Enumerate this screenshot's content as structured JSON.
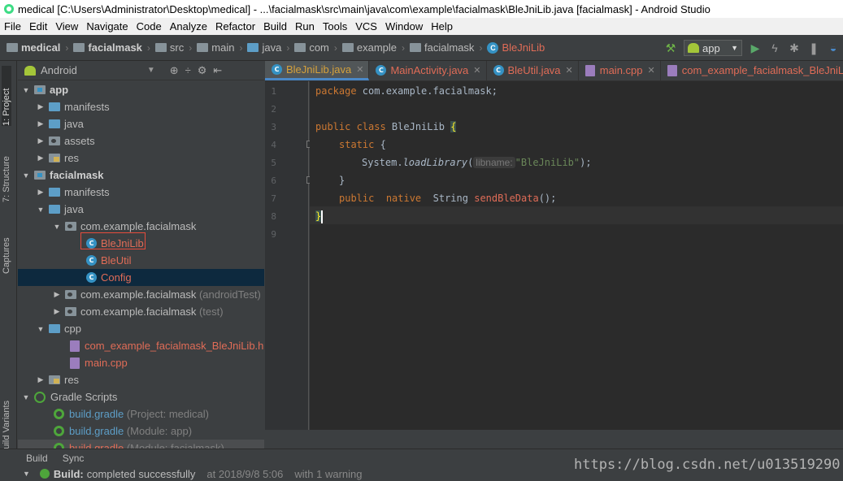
{
  "window": {
    "title": "medical [C:\\Users\\Administrator\\Desktop\\medical] - ...\\facialmask\\src\\main\\java\\com\\example\\facialmask\\BleJniLib.java [facialmask] - Android Studio"
  },
  "menu": [
    "File",
    "Edit",
    "View",
    "Navigate",
    "Code",
    "Analyze",
    "Refactor",
    "Build",
    "Run",
    "Tools",
    "VCS",
    "Window",
    "Help"
  ],
  "breadcrumb": {
    "c0": "medical",
    "c1": "facialmask",
    "c2": "src",
    "c3": "main",
    "c4": "java",
    "c5": "com",
    "c6": "example",
    "c7": "facialmask",
    "c8": "BleJniLib"
  },
  "run_config": "app",
  "left_tabs": {
    "project": "1: Project",
    "structure": "7: Structure",
    "captures": "Captures",
    "variants": "Build Variants"
  },
  "project": {
    "view": "Android",
    "tree": {
      "app": "app",
      "app_manifests": "manifests",
      "app_java": "java",
      "app_assets": "assets",
      "app_res": "res",
      "facialmask": "facialmask",
      "fm_manifests": "manifests",
      "fm_java": "java",
      "pkg_main": "com.example.facialmask",
      "blejnilib": "BleJniLib",
      "bleutil": "BleUtil",
      "config": "Config",
      "pkg_android_test": "com.example.facialmask",
      "pkg_android_test_hint": "(androidTest)",
      "pkg_test": "com.example.facialmask",
      "pkg_test_hint": "(test)",
      "cpp": "cpp",
      "header_file": "com_example_facialmask_BleJniLib.h",
      "main_cpp": "main.cpp",
      "fm_res": "res",
      "gradle_scripts": "Gradle Scripts",
      "bg1": "build.gradle",
      "bg1_hint": "(Project: medical)",
      "bg2": "build.gradle",
      "bg2_hint": "(Module: app)",
      "bg3": "build.gradle",
      "bg3_hint": "(Module: facialmask)"
    }
  },
  "editor": {
    "tabs": {
      "t0": "BleJniLib.java",
      "t1": "MainActivity.java",
      "t2": "BleUtil.java",
      "t3": "main.cpp",
      "t4": "com_example_facialmask_BleJniLib.h"
    },
    "line_numbers": [
      "1",
      "2",
      "3",
      "4",
      "5",
      "6",
      "7",
      "8",
      "9"
    ],
    "code": {
      "l1_kw": "package",
      "l1_rest": " com.example.facialmask;",
      "l3_kw": "public class",
      "l3_rest": " BleJniLib ",
      "l3_brace": "{",
      "l4_kw": "static",
      "l4_rest": " {",
      "l5_a": "System.",
      "l5_b": "loadLibrary",
      "l5_c": "(",
      "l5_hint": "libname:",
      "l5_str": "\"BleJniLib\"",
      "l5_d": ");",
      "l6": "}",
      "l7_kw1": "public",
      "l7_kw2": "native",
      "l7_type": "String",
      "l7_fn": "sendBleData",
      "l7_end": "();",
      "l8_brace": "}"
    }
  },
  "bottom_tabs": {
    "build": "Build",
    "sync": "Sync"
  },
  "status": {
    "build_label": "Build:",
    "build_text": "completed successfully",
    "time": "at 2018/9/8 5:06",
    "warn": "with 1 warning"
  },
  "watermark": "https://blog.csdn.net/u013519290"
}
